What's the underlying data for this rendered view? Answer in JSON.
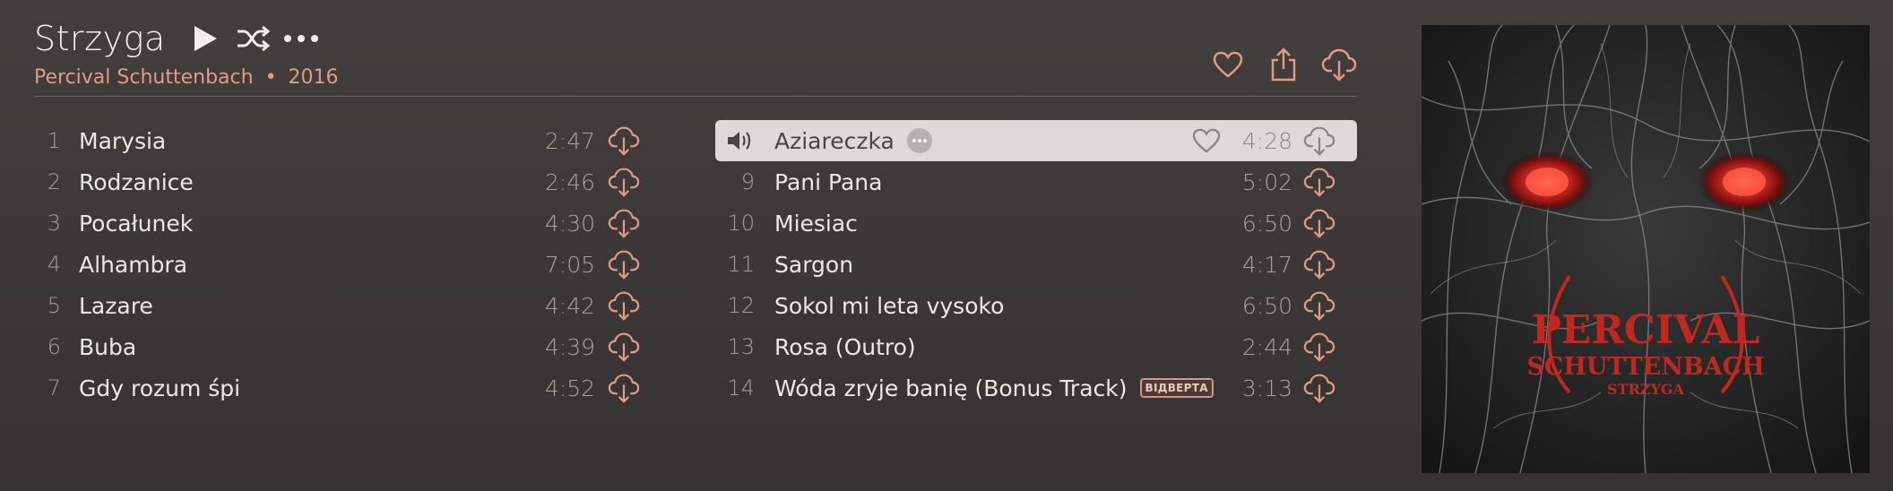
{
  "album": {
    "title": "Strzyga",
    "artist": "Percival Schuttenbach",
    "separator": "•",
    "year": "2016",
    "cover_alt_text": [
      "PERCIVAL",
      "SCHUTTENBACH",
      "STRZYGA"
    ]
  },
  "header_icons": {
    "play": "play-icon",
    "shuffle": "shuffle-icon",
    "more": "more-icon",
    "love": "heart-icon",
    "share": "share-icon",
    "download": "cloud-download-icon"
  },
  "colors": {
    "accent": "#e29a84",
    "background": "#3e3b3a",
    "highlight": "#dcd9d7"
  },
  "tracks_left": [
    {
      "num": "1",
      "name": "Marysia",
      "duration": "2:47"
    },
    {
      "num": "2",
      "name": "Rodzanice",
      "duration": "2:46"
    },
    {
      "num": "3",
      "name": "Pocałunek",
      "duration": "4:30"
    },
    {
      "num": "4",
      "name": "Alhambra",
      "duration": "7:05"
    },
    {
      "num": "5",
      "name": "Lazare",
      "duration": "4:42"
    },
    {
      "num": "6",
      "name": "Buba",
      "duration": "4:39"
    },
    {
      "num": "7",
      "name": "Gdy rozum śpi",
      "duration": "4:52"
    }
  ],
  "tracks_right": [
    {
      "num": "",
      "name": "Aziareczka",
      "duration": "4:28",
      "playing": true
    },
    {
      "num": "9",
      "name": "Pani Pana",
      "duration": "5:02"
    },
    {
      "num": "10",
      "name": "Miesiac",
      "duration": "6:50"
    },
    {
      "num": "11",
      "name": "Sargon",
      "duration": "4:17"
    },
    {
      "num": "12",
      "name": "Sokol mi leta vysoko",
      "duration": "6:50"
    },
    {
      "num": "13",
      "name": "Rosa (Outro)",
      "duration": "2:44"
    },
    {
      "num": "14",
      "name": "Wóda zryje banię (Bonus Track)",
      "duration": "3:13",
      "badge": "ВІДВЕРТА"
    }
  ]
}
